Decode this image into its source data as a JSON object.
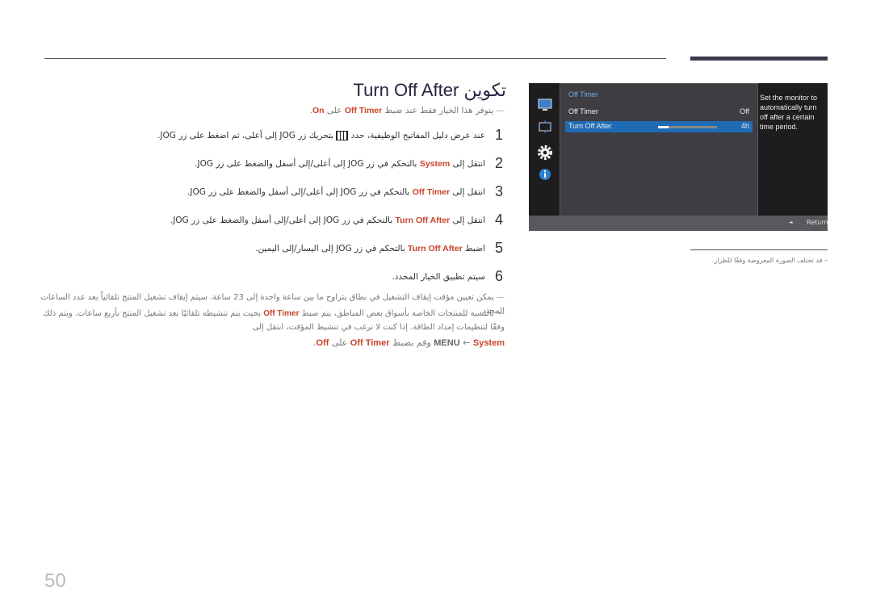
{
  "title": {
    "ar": "تكوين",
    "en": "Turn Off After"
  },
  "prenote": {
    "a": "يتوفر هذا الخيار فقط عند ضبط",
    "hl1": "Off Timer",
    "b": "على",
    "hl2": "On",
    "c": "."
  },
  "steps": [
    {
      "num": "1",
      "a": "عند عرض دليل المفاتيح الوظيفية، حدد",
      "icon": "menu-grid-icon",
      "b": "بتحريك زر JOG إلى أعلى، ثم اضغط على زر JOG."
    },
    {
      "num": "2",
      "a": "انتقل إلى",
      "hl": "System",
      "b": "بالتحكم في زر JOG إلى أعلى/إلى أسفل والضغط على زر JOG."
    },
    {
      "num": "3",
      "a": "انتقل إلى",
      "hl": "Off Timer",
      "b": "بالتحكم في زر JOG إلى أعلى/إلى أسفل والضغط على زر JOG."
    },
    {
      "num": "4",
      "a": "انتقل إلى",
      "hl": "Turn Off After",
      "b": "بالتحكم في زر JOG إلى أعلى/إلى أسفل والضغط على زر JOG."
    },
    {
      "num": "5",
      "a": "اضبط",
      "hl": "Turn Off After",
      "b": "بالتحكم في زر JOG إلى اليسار/إلى اليمين."
    },
    {
      "num": "6",
      "a": "سيتم تطبيق الخيار المحدد."
    }
  ],
  "notes": {
    "n1": "يمكن تعيين مؤقت إيقاف التشغيل في نطاق يتراوح ما بين ساعة واحدة إلى 23 ساعة. سيتم إيقاف تشغيل المنتج تلقائياً بعد عدد الساعات المحدد.",
    "n2a": "بالنسبة للمنتجات الخاصة بأسواق بعض المناطق، يتم ضبط",
    "n2hl": "Off Timer",
    "n2b": "بحيث يتم تنشيطه تلقائيًا بعد تشغيل المنتج بأربع ساعات. ويتم ذلك وفقًا لتنظيمات إمداد الطاقة. إذا كنت لا ترغب في تنشيط المؤقت، انتقل إلى",
    "n3menu": "MENU",
    "n3arrow": "←",
    "n3hl1": "System",
    "n3a": "وقم بضبط",
    "n3hl2": "Off Timer",
    "n3b": "على",
    "n3hl3": "Off",
    "n3c": "."
  },
  "osd": {
    "header": "Off Timer",
    "rows": [
      {
        "label": "Off Timer",
        "value": "Off"
      },
      {
        "label": "Turn Off After",
        "value": "4h",
        "slider_fraction": 0.18
      }
    ],
    "description": "Set the monitor to automatically turn off after a certain time period.",
    "return": "Return",
    "icons": [
      "picture-icon",
      "size-position-icon",
      "settings-gear-icon",
      "info-icon"
    ],
    "accent": "#1f6bb5"
  },
  "caption": "– قد تختلف الصورة المعروضة وفقًا للطراز.",
  "page_number": "50"
}
